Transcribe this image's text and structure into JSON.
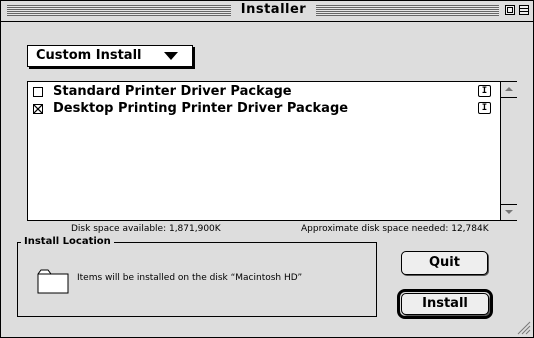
{
  "window": {
    "title": "Installer"
  },
  "install_type": {
    "selected": "Custom Install"
  },
  "packages": [
    {
      "label": "Standard Printer Driver Package",
      "checked": false,
      "info_glyph": "I"
    },
    {
      "label": "Desktop Printing Printer Driver Package",
      "checked": true,
      "info_glyph": "I"
    }
  ],
  "disk": {
    "available": "Disk space available: 1,871,900K",
    "needed": "Approximate disk space needed: 12,784K"
  },
  "install_location": {
    "heading": "Install Location",
    "description": "Items will be installed on the disk “Macintosh HD”"
  },
  "buttons": {
    "quit": "Quit",
    "install": "Install"
  },
  "icons": [
    "zoom-box-icon",
    "collapse-box-icon",
    "popup-arrow-icon",
    "info-icon",
    "scroll-up-arrow-icon",
    "scroll-down-arrow-icon",
    "folder-icon",
    "grow-box-icon"
  ]
}
